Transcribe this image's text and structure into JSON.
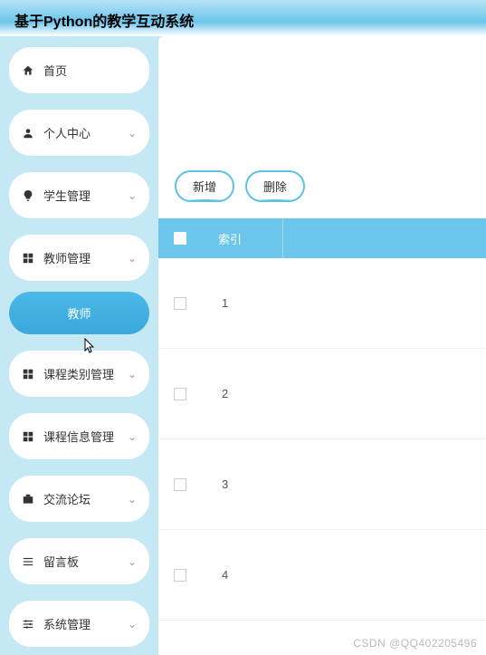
{
  "header": {
    "title": "基于Python的教学互动系统"
  },
  "sidebar": {
    "items": [
      {
        "label": "首页",
        "icon": "home",
        "expandable": false
      },
      {
        "label": "个人中心",
        "icon": "user",
        "expandable": true
      },
      {
        "label": "学生管理",
        "icon": "bulb",
        "expandable": true
      },
      {
        "label": "教师管理",
        "icon": "grid",
        "expandable": true,
        "expanded": true,
        "sub": [
          {
            "label": "教师"
          }
        ]
      },
      {
        "label": "课程类别管理",
        "icon": "grid",
        "expandable": true
      },
      {
        "label": "课程信息管理",
        "icon": "grid",
        "expandable": true
      },
      {
        "label": "交流论坛",
        "icon": "briefcase",
        "expandable": true
      },
      {
        "label": "留言板",
        "icon": "list",
        "expandable": true
      },
      {
        "label": "系统管理",
        "icon": "sliders",
        "expandable": true
      }
    ]
  },
  "actions": {
    "add": "新增",
    "delete": "删除"
  },
  "table": {
    "headers": {
      "index": "索引"
    },
    "rows": [
      {
        "index": "1"
      },
      {
        "index": "2"
      },
      {
        "index": "3"
      },
      {
        "index": "4"
      }
    ]
  },
  "watermark": "CSDN @QQ402205496"
}
